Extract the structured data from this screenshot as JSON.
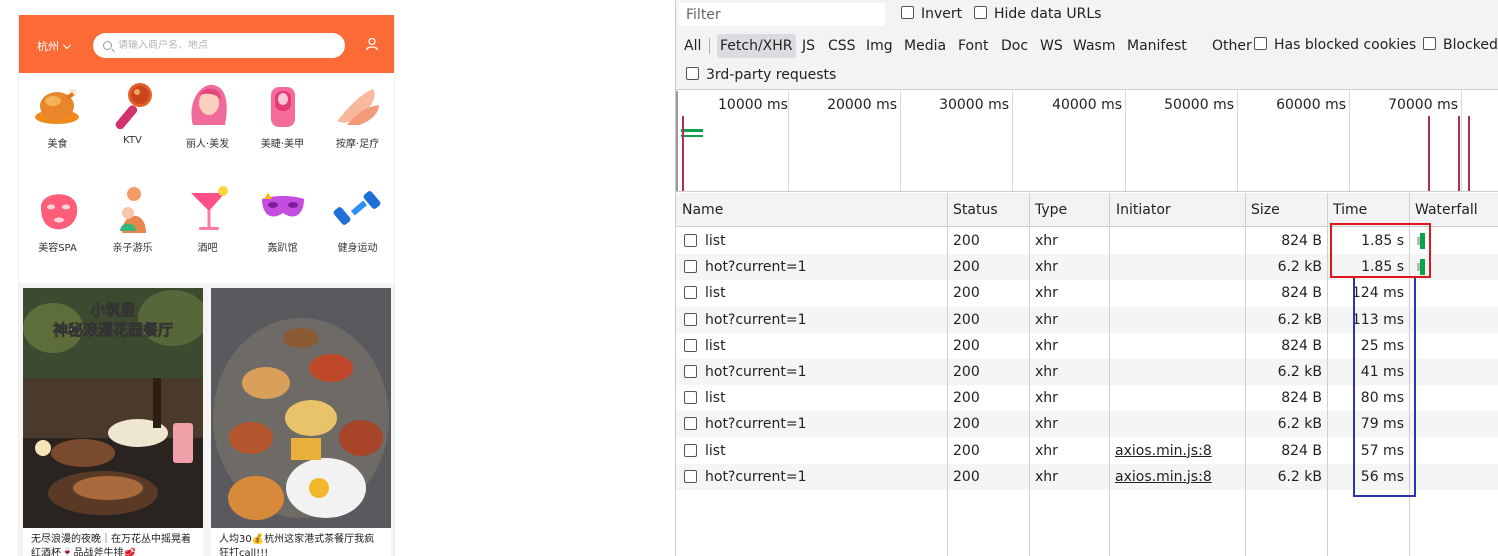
{
  "app": {
    "city": "杭州",
    "search_placeholder": "请输入商户名、地点",
    "categories": [
      {
        "label": "美食",
        "icon": "roast-chicken-icon"
      },
      {
        "label": "KTV",
        "icon": "microphone-icon"
      },
      {
        "label": "丽人·美发",
        "icon": "hair-salon-icon"
      },
      {
        "label": "美睫·美甲",
        "icon": "nail-polish-icon"
      },
      {
        "label": "按摩·足疗",
        "icon": "massage-hands-icon"
      },
      {
        "label": "美容SPA",
        "icon": "face-mask-icon"
      },
      {
        "label": "亲子游乐",
        "icon": "parent-child-icon"
      },
      {
        "label": "酒吧",
        "icon": "cocktail-icon"
      },
      {
        "label": "轰趴馆",
        "icon": "party-mask-icon"
      },
      {
        "label": "健身运动",
        "icon": "dumbbell-icon"
      }
    ],
    "feed": [
      {
        "image_text_line1": "小筑里",
        "image_text_line2": "神秘浪漫花园餐厅",
        "caption": "无尽浪漫的夜晚｜在万花丛中摇晃着红酒杯🍷品战斧牛排🥩"
      },
      {
        "image_text_line1": "",
        "image_text_line2": "",
        "caption": "人均30💰杭州这家港式茶餐厅我疯狂打call!!!"
      }
    ],
    "colors": {
      "brand": "#fc6a35"
    }
  },
  "devtools": {
    "filter_placeholder": "Filter",
    "invert_label": "Invert",
    "hide_data_urls_label": "Hide data URLs",
    "type_filters": [
      "All",
      "Fetch/XHR",
      "JS",
      "CSS",
      "Img",
      "Media",
      "Font",
      "Doc",
      "WS",
      "Wasm",
      "Manifest",
      "Other"
    ],
    "active_type": "Fetch/XHR",
    "has_blocked_cookies_label": "Has blocked cookies",
    "blocked_label": "Blocked",
    "third_party_label": "3rd-party requests",
    "overview_ticks": [
      "10000 ms",
      "20000 ms",
      "30000 ms",
      "40000 ms",
      "50000 ms",
      "60000 ms",
      "70000 ms"
    ],
    "columns": [
      "Name",
      "Status",
      "Type",
      "Initiator",
      "Size",
      "Time",
      "Waterfall"
    ],
    "rows": [
      {
        "name": "list",
        "status": "200",
        "type": "xhr",
        "initiator": "",
        "size": "824 B",
        "time": "1.85 s",
        "waterfall": true
      },
      {
        "name": "hot?current=1",
        "status": "200",
        "type": "xhr",
        "initiator": "",
        "size": "6.2 kB",
        "time": "1.85 s",
        "waterfall": true
      },
      {
        "name": "list",
        "status": "200",
        "type": "xhr",
        "initiator": "",
        "size": "824 B",
        "time": "124 ms",
        "waterfall": false
      },
      {
        "name": "hot?current=1",
        "status": "200",
        "type": "xhr",
        "initiator": "",
        "size": "6.2 kB",
        "time": "113 ms",
        "waterfall": false
      },
      {
        "name": "list",
        "status": "200",
        "type": "xhr",
        "initiator": "",
        "size": "824 B",
        "time": "25 ms",
        "waterfall": false
      },
      {
        "name": "hot?current=1",
        "status": "200",
        "type": "xhr",
        "initiator": "",
        "size": "6.2 kB",
        "time": "41 ms",
        "waterfall": false
      },
      {
        "name": "list",
        "status": "200",
        "type": "xhr",
        "initiator": "",
        "size": "824 B",
        "time": "80 ms",
        "waterfall": false
      },
      {
        "name": "hot?current=1",
        "status": "200",
        "type": "xhr",
        "initiator": "",
        "size": "6.2 kB",
        "time": "79 ms",
        "waterfall": false
      },
      {
        "name": "list",
        "status": "200",
        "type": "xhr",
        "initiator": "axios.min.js:8",
        "size": "824 B",
        "time": "57 ms",
        "waterfall": false
      },
      {
        "name": "hot?current=1",
        "status": "200",
        "type": "xhr",
        "initiator": "axios.min.js:8",
        "size": "6.2 kB",
        "time": "56 ms",
        "waterfall": false
      }
    ],
    "colors": {
      "highlight_red": "#e0161b",
      "highlight_blue": "#2a36b0",
      "waterfall_green": "#0fa14a"
    }
  }
}
